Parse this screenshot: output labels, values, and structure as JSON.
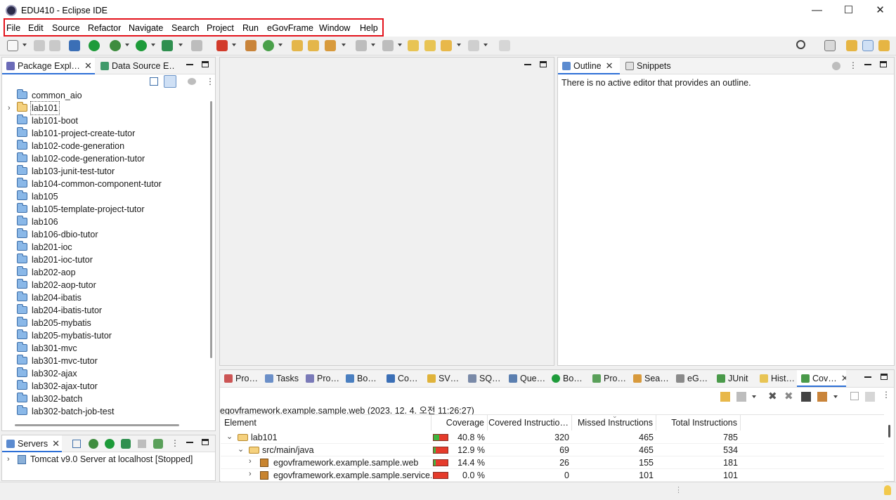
{
  "window": {
    "title": "EDU410 - Eclipse IDE",
    "minimize_glyph": "—",
    "maximize_glyph": "☐",
    "close_glyph": "✕"
  },
  "menu": [
    "File",
    "Edit",
    "Source",
    "Refactor",
    "Navigate",
    "Search",
    "Project",
    "Run",
    "eGovFrame",
    "Window",
    "Help"
  ],
  "package_explorer": {
    "tabs": [
      {
        "label": "Package Expl…",
        "active": true
      },
      {
        "label": "Data Source E…",
        "active": false
      }
    ],
    "items": [
      {
        "label": "common_aio",
        "type": "folder",
        "expandable": false
      },
      {
        "label": "lab101",
        "type": "project",
        "expandable": true,
        "selected": true
      },
      {
        "label": "lab101-boot",
        "type": "folder",
        "expandable": false
      },
      {
        "label": "lab101-project-create-tutor",
        "type": "folder",
        "expandable": false
      },
      {
        "label": "lab102-code-generation",
        "type": "folder",
        "expandable": false
      },
      {
        "label": "lab102-code-generation-tutor",
        "type": "folder",
        "expandable": false
      },
      {
        "label": "lab103-junit-test-tutor",
        "type": "folder",
        "expandable": false
      },
      {
        "label": "lab104-common-component-tutor",
        "type": "folder",
        "expandable": false
      },
      {
        "label": "lab105",
        "type": "folder",
        "expandable": false
      },
      {
        "label": "lab105-template-project-tutor",
        "type": "folder",
        "expandable": false
      },
      {
        "label": "lab106",
        "type": "folder",
        "expandable": false
      },
      {
        "label": "lab106-dbio-tutor",
        "type": "folder",
        "expandable": false
      },
      {
        "label": "lab201-ioc",
        "type": "folder",
        "expandable": false
      },
      {
        "label": "lab201-ioc-tutor",
        "type": "folder",
        "expandable": false
      },
      {
        "label": "lab202-aop",
        "type": "folder",
        "expandable": false
      },
      {
        "label": "lab202-aop-tutor",
        "type": "folder",
        "expandable": false
      },
      {
        "label": "lab204-ibatis",
        "type": "folder",
        "expandable": false
      },
      {
        "label": "lab204-ibatis-tutor",
        "type": "folder",
        "expandable": false
      },
      {
        "label": "lab205-mybatis",
        "type": "folder",
        "expandable": false
      },
      {
        "label": "lab205-mybatis-tutor",
        "type": "folder",
        "expandable": false
      },
      {
        "label": "lab301-mvc",
        "type": "folder",
        "expandable": false
      },
      {
        "label": "lab301-mvc-tutor",
        "type": "folder",
        "expandable": false
      },
      {
        "label": "lab302-ajax",
        "type": "folder",
        "expandable": false
      },
      {
        "label": "lab302-ajax-tutor",
        "type": "folder",
        "expandable": false
      },
      {
        "label": "lab302-batch",
        "type": "folder",
        "expandable": false
      },
      {
        "label": "lab302-batch-job-test",
        "type": "folder",
        "expandable": false
      }
    ]
  },
  "servers": {
    "tab_label": "Servers",
    "item": "Tomcat v9.0 Server at localhost  [Stopped]"
  },
  "outline": {
    "tabs": [
      {
        "label": "Outline",
        "active": true
      },
      {
        "label": "Snippets",
        "active": false
      }
    ],
    "message": "There is no active editor that provides an outline."
  },
  "bottom_panel": {
    "tabs": [
      "Pro…",
      "Tasks",
      "Pro…",
      "Bo…",
      "Co…",
      "SV…",
      "SQ…",
      "Que…",
      "Bo…",
      "Pro…",
      "Sea…",
      "eG…",
      "JUnit",
      "Hist…",
      "Cov…"
    ],
    "session_label": "egovframework.example.sample.web (2023. 12. 4. 오전 11:26:27)",
    "columns": [
      "Element",
      "Coverage",
      "Covered Instructio…",
      "Missed Instructions",
      "Total Instructions"
    ],
    "rows": [
      {
        "element": "lab101",
        "coverage": "40.8 %",
        "coverage_fraction": 0.408,
        "covered": "320",
        "missed": "465",
        "total": "785",
        "level": 0,
        "expanded": true,
        "icon": "project"
      },
      {
        "element": "src/main/java",
        "coverage": "12.9 %",
        "coverage_fraction": 0.129,
        "covered": "69",
        "missed": "465",
        "total": "534",
        "level": 1,
        "expanded": true,
        "icon": "srcfolder"
      },
      {
        "element": "egovframework.example.sample.web",
        "coverage": "14.4 %",
        "coverage_fraction": 0.144,
        "covered": "26",
        "missed": "155",
        "total": "181",
        "level": 2,
        "expanded": false,
        "icon": "package"
      },
      {
        "element": "egovframework.example.sample.service.im",
        "coverage": "0.0 %",
        "coverage_fraction": 0.0,
        "covered": "0",
        "missed": "101",
        "total": "101",
        "level": 2,
        "expanded": false,
        "icon": "package"
      }
    ]
  },
  "colors": {
    "highlight_box": "#e3121b",
    "active_tab_underline": "#2d6fd6",
    "coverage_green": "#3fb43f",
    "coverage_red": "#e53b2b"
  }
}
